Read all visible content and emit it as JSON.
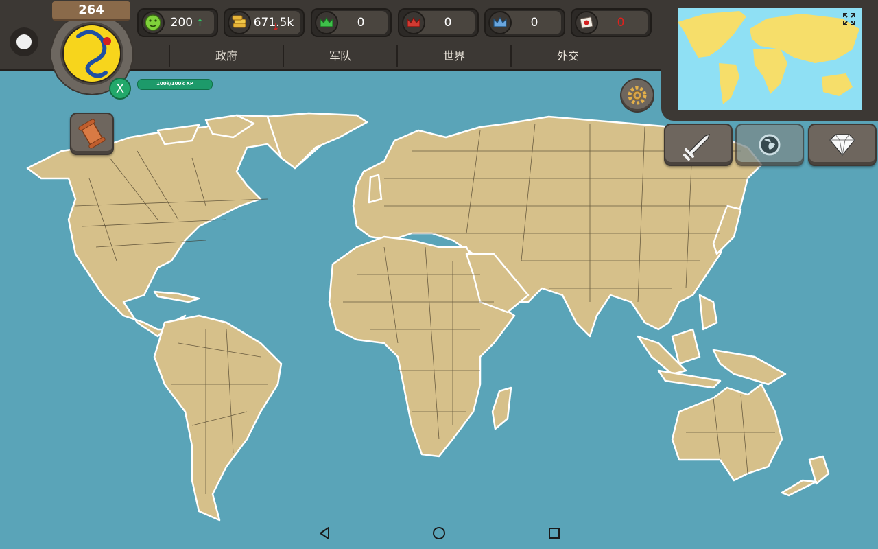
{
  "player": {
    "level": "264",
    "badge_letter": "X",
    "xp_text": "100k/100k XP"
  },
  "resources": [
    {
      "name": "happiness",
      "icon": "smiley-icon",
      "value": "200",
      "trend": "up",
      "trend_color": "#2fd06a"
    },
    {
      "name": "money",
      "icon": "coins-icon",
      "value": "671.5k",
      "trend": "down",
      "trend_color": "#e0201c"
    },
    {
      "name": "green-crown",
      "icon": "green-crown-icon",
      "value": "0"
    },
    {
      "name": "red-crown",
      "icon": "red-crown-icon",
      "value": "0"
    },
    {
      "name": "blue-crown",
      "icon": "blue-crown-icon",
      "value": "0"
    },
    {
      "name": "flag-card",
      "icon": "flag-card-icon",
      "value": "0",
      "value_color": "#e0201c"
    }
  ],
  "tabs": [
    "政府",
    "军队",
    "世界",
    "外交"
  ],
  "actions": {
    "left_scroll": "scroll-icon",
    "settings": "gear-icon",
    "war": "sword-icon",
    "globe": "globe-icon",
    "gems": "diamond-icon",
    "expand": "expand-icon"
  },
  "colors": {
    "ocean": "#5aa4b8",
    "land": "#d6c08a",
    "bar": "#3c3834",
    "xp": "#1d9a6a",
    "minimap_ocean": "#8fe0f4",
    "minimap_land": "#f6de6a"
  },
  "android_nav": [
    "back-icon",
    "home-icon",
    "recents-icon"
  ]
}
